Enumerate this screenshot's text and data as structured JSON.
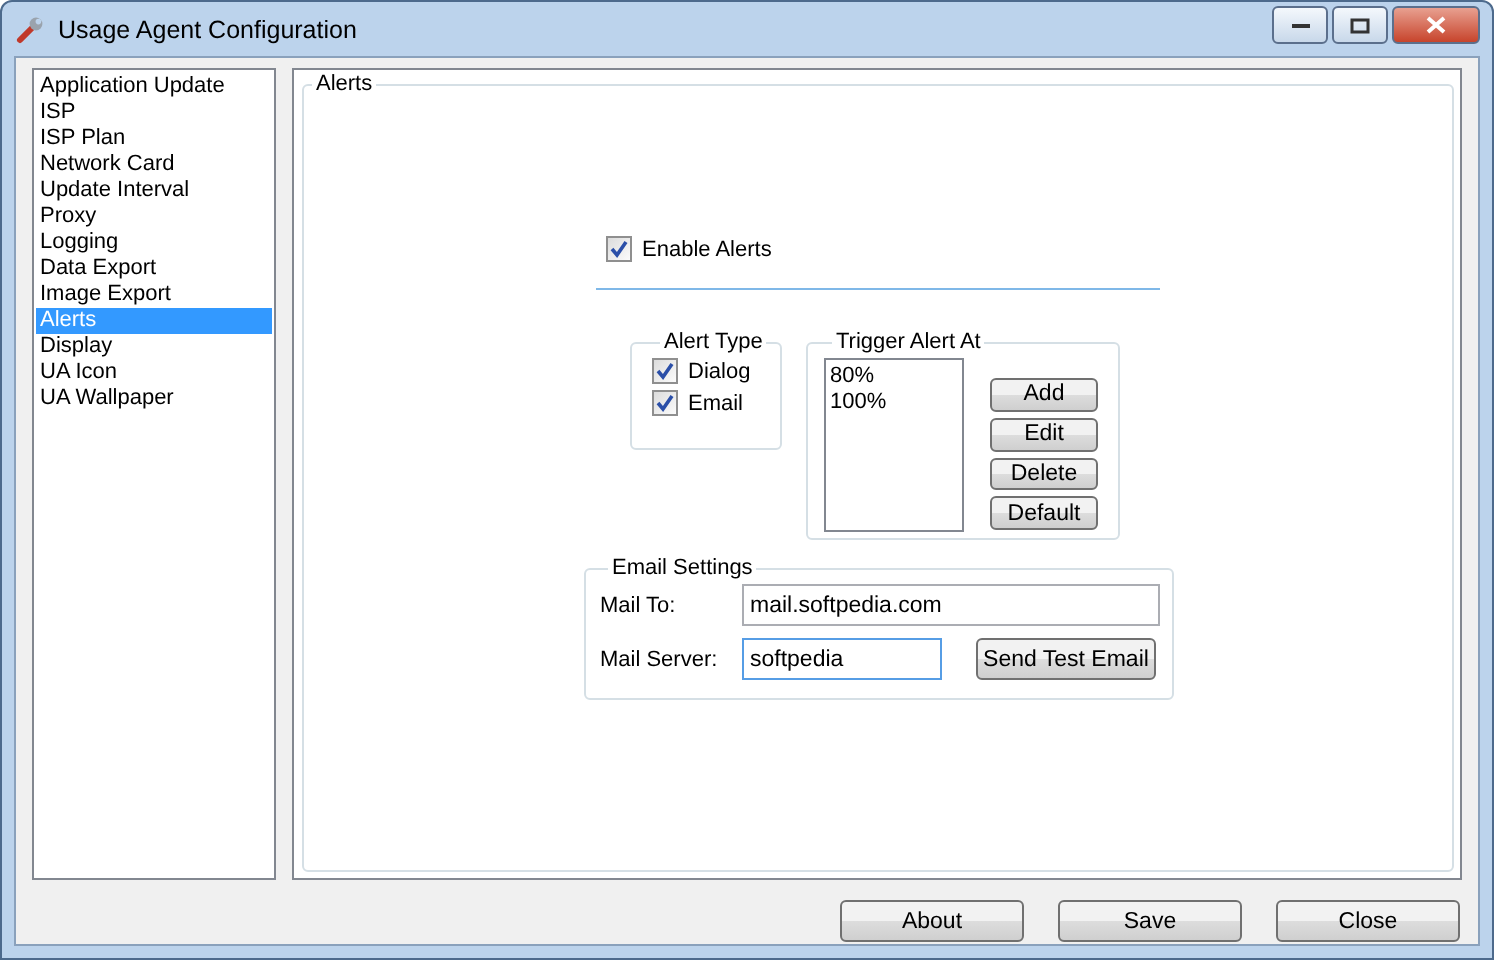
{
  "window": {
    "title": "Usage Agent Configuration"
  },
  "sidebar": {
    "items": [
      {
        "label": "Application Update",
        "selected": false
      },
      {
        "label": "ISP",
        "selected": false
      },
      {
        "label": "ISP Plan",
        "selected": false
      },
      {
        "label": "Network Card",
        "selected": false
      },
      {
        "label": "Update Interval",
        "selected": false
      },
      {
        "label": "Proxy",
        "selected": false
      },
      {
        "label": "Logging",
        "selected": false
      },
      {
        "label": "Data Export",
        "selected": false
      },
      {
        "label": "Image Export",
        "selected": false
      },
      {
        "label": "Alerts",
        "selected": true
      },
      {
        "label": "Display",
        "selected": false
      },
      {
        "label": "UA Icon",
        "selected": false
      },
      {
        "label": "UA Wallpaper",
        "selected": false
      }
    ]
  },
  "panel": {
    "title": "Alerts",
    "enable_alerts": {
      "label": "Enable Alerts",
      "checked": true
    },
    "alert_type": {
      "title": "Alert Type",
      "options": [
        {
          "label": "Dialog",
          "checked": true
        },
        {
          "label": "Email",
          "checked": true
        }
      ]
    },
    "trigger": {
      "title": "Trigger Alert At",
      "items": [
        {
          "label": "80%",
          "selected": false
        },
        {
          "label": "100%",
          "selected": false
        }
      ],
      "buttons": [
        "Add",
        "Edit",
        "Delete",
        "Default"
      ]
    },
    "email_settings": {
      "title": "Email Settings",
      "mail_to": {
        "label": "Mail To:",
        "value": "mail.softpedia.com"
      },
      "mail_server": {
        "label": "Mail Server:",
        "value": "softpedia"
      },
      "test_button": "Send Test Email"
    }
  },
  "buttons": [
    "About",
    "Save",
    "Close"
  ]
}
